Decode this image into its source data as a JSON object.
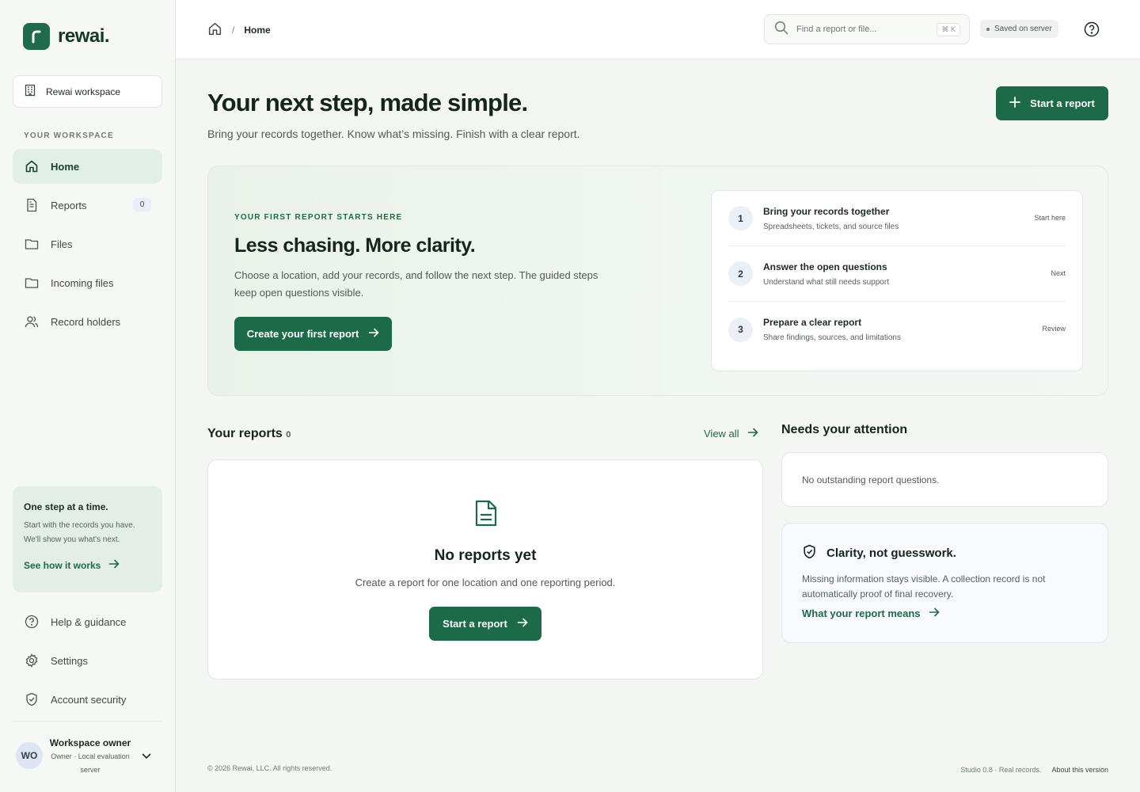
{
  "app": {
    "brand": "rewai."
  },
  "sidebar": {
    "workspace_name": "Rewai workspace",
    "section_label": "YOUR WORKSPACE",
    "items": [
      {
        "label": "Home",
        "icon": "home-icon"
      },
      {
        "label": "Reports",
        "icon": "document-icon",
        "badge": "0"
      },
      {
        "label": "Files",
        "icon": "folder-icon"
      },
      {
        "label": "Incoming files",
        "icon": "inbox-folder-icon"
      },
      {
        "label": "Record holders",
        "icon": "users-icon"
      }
    ],
    "tip": {
      "title": "One step at a time.",
      "body": "Start with the records you have. We'll show you what's next.",
      "link": "See how it works"
    },
    "bottom_items": [
      {
        "label": "Help & guidance",
        "icon": "help-circle-icon"
      },
      {
        "label": "Settings",
        "icon": "gear-icon"
      },
      {
        "label": "Account security",
        "icon": "shield-icon"
      }
    ],
    "user": {
      "initials": "WO",
      "name": "Workspace owner",
      "meta": "Owner · Local evaluation server"
    }
  },
  "topbar": {
    "breadcrumb_current": "Home",
    "breadcrumb_sep": "/",
    "search_placeholder": "Find a report or file...",
    "search_shortcut": "⌘ K",
    "status": "Saved on server"
  },
  "hero": {
    "title": "Your next step, made simple.",
    "subtitle": "Bring your records together. Know what’s missing. Finish with a clear report.",
    "start_button": "Start a report"
  },
  "onboarding": {
    "eyebrow": "YOUR FIRST REPORT STARTS HERE",
    "title": "Less chasing. More clarity.",
    "body": "Choose a location, add your records, and follow the next step. The guided steps keep open questions visible.",
    "cta": "Create your first report",
    "steps": [
      {
        "num": "1",
        "title": "Bring your records together",
        "desc": "Spreadsheets, tickets, and source files",
        "tag": "Start here"
      },
      {
        "num": "2",
        "title": "Answer the open questions",
        "desc": "Understand what still needs support",
        "tag": "Next"
      },
      {
        "num": "3",
        "title": "Prepare a clear report",
        "desc": "Share findings, sources, and limitations",
        "tag": "Review"
      }
    ]
  },
  "reports": {
    "heading": "Your reports",
    "count": "0",
    "view_all": "View all",
    "empty_title": "No reports yet",
    "empty_sub": "Create a report for one location and one reporting period.",
    "empty_button": "Start a report"
  },
  "attention": {
    "heading": "Needs your attention",
    "empty": "No outstanding report questions.",
    "clarity_title": "Clarity, not guesswork.",
    "clarity_body": "Missing information stays visible. A collection record is not automatically proof of final recovery.",
    "clarity_link": "What your report means"
  },
  "footer": {
    "copyright": "© 2026 Rewai, LLC. All rights reserved.",
    "version": "Studio 0.8 · Real records.",
    "about": "About this version"
  },
  "colors": {
    "brand": "#1d6a48",
    "active_nav_bg": "#e2efe6"
  }
}
